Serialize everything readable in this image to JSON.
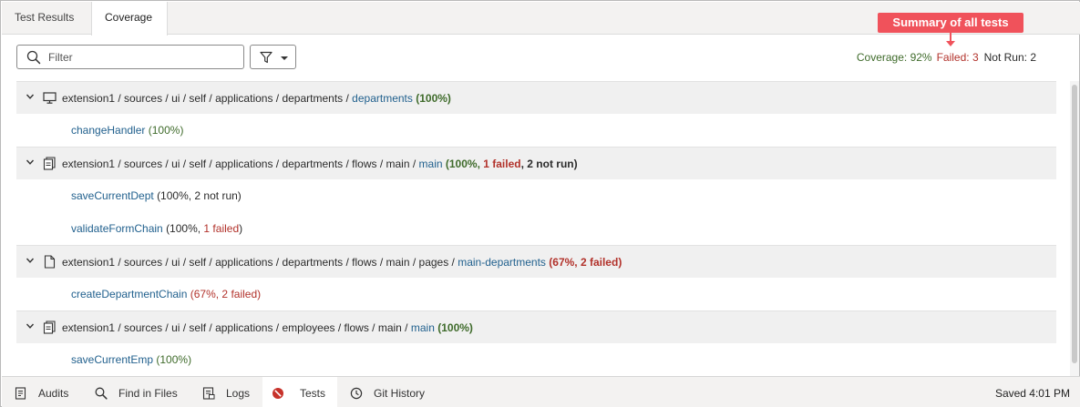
{
  "tabs": [
    {
      "label": "Test Results",
      "active": false
    },
    {
      "label": "Coverage",
      "active": true
    }
  ],
  "callout": {
    "text": "Summary of all tests",
    "color": "#f0525b"
  },
  "toolbar": {
    "filter_placeholder": "Filter",
    "filter_value": "",
    "filter_button_icon": "funnel-icon"
  },
  "summary": {
    "coverage": "Coverage: 92%",
    "failed": "Failed: 3",
    "not_run": "Not Run: 2"
  },
  "groups": [
    {
      "icon": "monitor-icon",
      "path": "extension1 / sources / ui / self / applications / departments / ",
      "link": "departments",
      "stats": "(100%)",
      "items": [
        {
          "name": "changeHandler",
          "stats": "(100%)"
        }
      ]
    },
    {
      "icon": "flow-document-icon",
      "path": "extension1 / sources / ui / self / applications / departments / flows / main / ",
      "link": "main",
      "stats_pct": "(100%, ",
      "stats_failed": "1 failed",
      "stats_notrun": ", 2 not run)",
      "items": [
        {
          "name": "saveCurrentDept",
          "stats": "(100%, 2 not run)"
        },
        {
          "name": "validateFormChain",
          "stats_pre": "(100%, ",
          "stats_failed": "1 failed",
          "stats_post": ")"
        }
      ]
    },
    {
      "icon": "page-document-icon",
      "path": "extension1 / sources / ui / self / applications / departments / flows / main / pages / ",
      "link": "main-departments",
      "stats": "(67%, 2 failed)",
      "items": [
        {
          "name": "createDepartmentChain",
          "stats": "(67%, 2 failed)"
        }
      ]
    },
    {
      "icon": "flow-document-icon",
      "path": "extension1 / sources / ui / self / applications / employees / flows / main / ",
      "link": "main",
      "stats": "(100%)",
      "items": [
        {
          "name": "saveCurrentEmp",
          "stats": "(100%)"
        }
      ]
    }
  ],
  "bottom_tabs": [
    {
      "label": "Audits",
      "icon": "audit-icon"
    },
    {
      "label": "Find in Files",
      "icon": "search-icon"
    },
    {
      "label": "Logs",
      "icon": "logs-icon"
    },
    {
      "label": "Tests",
      "icon": "tests-error-icon",
      "active": true
    },
    {
      "label": "Git History",
      "icon": "history-icon"
    }
  ],
  "status": {
    "saved": "Saved 4:01 PM"
  },
  "colors": {
    "accent_red": "#b2322b",
    "green": "#3f6b2b",
    "link": "#22618e",
    "error_icon": "#c7322b"
  }
}
